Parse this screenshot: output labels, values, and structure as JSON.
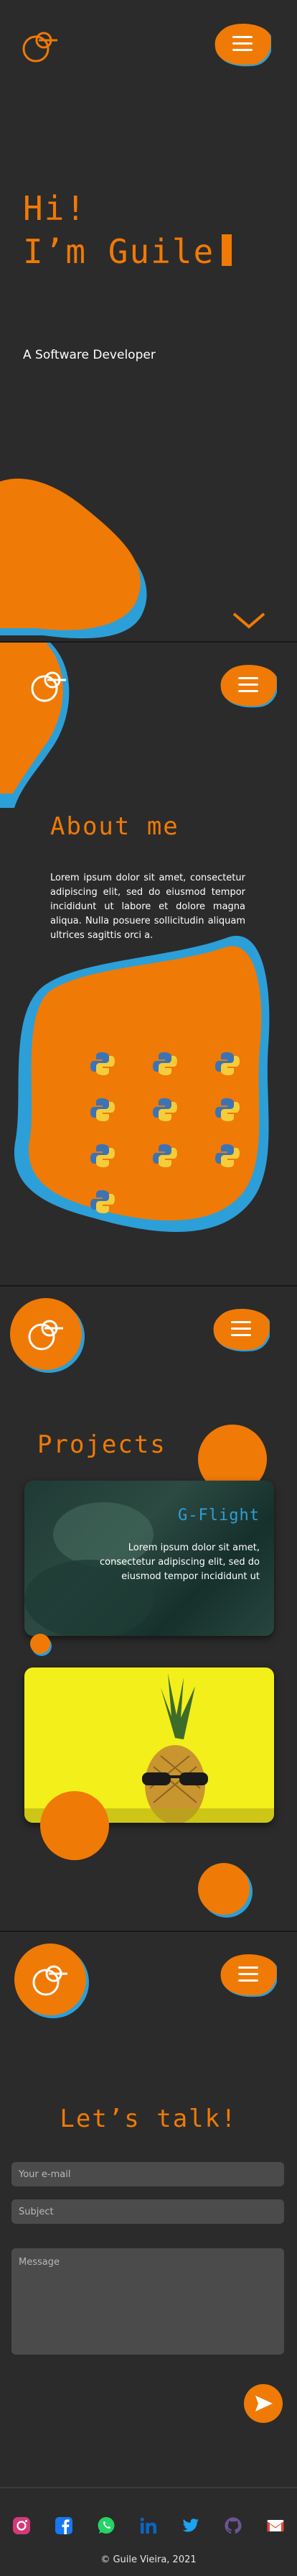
{
  "colors": {
    "accent": "#f07a06",
    "secondary": "#2c9fd8",
    "background": "#2b2b2b"
  },
  "logo": {
    "icon": "guile-logo-icon"
  },
  "menu": {
    "icon": "hamburger-menu-icon"
  },
  "hero": {
    "line1": "Hi!",
    "line2": "I’m Guile",
    "subtitle": "A Software Developer",
    "scroll_icon": "chevron-down-icon"
  },
  "about": {
    "title": "About me",
    "text": "Lorem ipsum dolor sit amet, consectetur adipiscing elit, sed do eiusmod tempor incididunt ut labore et dolore magna aliqua. Nulla posuere sollicitudin aliquam ultrices sagittis orci a.",
    "skill_icons": [
      "python-icon",
      "python-icon",
      "python-icon",
      "python-icon",
      "python-icon",
      "python-icon",
      "python-icon",
      "python-icon",
      "python-icon",
      "python-icon"
    ]
  },
  "projects": {
    "title": "Projects",
    "items": [
      {
        "title": "G-Flight",
        "description": "Lorem ipsum dolor sit amet, consectetur adipiscing elit, sed do eiusmod tempor incididunt ut"
      },
      {
        "image": "pineapple-sunglasses-image"
      }
    ]
  },
  "contact": {
    "title": "Let’s talk!",
    "email_placeholder": "Your e-mail",
    "subject_placeholder": "Subject",
    "message_placeholder": "Message",
    "send_icon": "send-arrow-icon"
  },
  "footer": {
    "icons": [
      "instagram-icon",
      "facebook-icon",
      "whatsapp-icon",
      "linkedin-icon",
      "twitter-icon",
      "github-icon",
      "gmail-icon"
    ],
    "copyright": "© Guile Vieira, 2021"
  }
}
